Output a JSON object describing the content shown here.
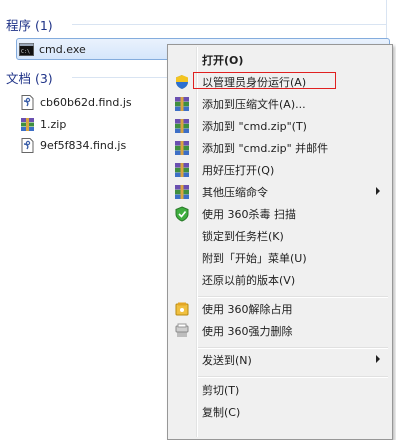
{
  "programs": {
    "header": "程序 (1)",
    "items": [
      {
        "name": "cmd.exe"
      }
    ]
  },
  "documents": {
    "header": "文档 (3)",
    "items": [
      {
        "name": "cb60b62d.find.js",
        "icon": "js-file-icon"
      },
      {
        "name": "1.zip",
        "icon": "zip-archive-icon"
      },
      {
        "name": "9ef5f834.find.js",
        "icon": "js-file-icon"
      }
    ]
  },
  "context_menu": {
    "items": [
      {
        "label": "打开(O)",
        "bold": true
      },
      {
        "label": "以管理员身份运行(A)",
        "icon": "uac-shield-icon",
        "highlighted": true
      },
      {
        "label": "添加到压缩文件(A)...",
        "icon": "winrar-icon"
      },
      {
        "label": "添加到 \"cmd.zip\"(T)",
        "icon": "winrar-icon"
      },
      {
        "label": "添加到 \"cmd.zip\" 并邮件",
        "icon": "winrar-icon"
      },
      {
        "label": "用好压打开(Q)",
        "icon": "winrar-icon"
      },
      {
        "label": "其他压缩命令",
        "icon": "winrar-icon",
        "submenu": true
      },
      {
        "label": "使用 360杀毒 扫描",
        "icon": "360-shield-icon"
      },
      {
        "label": "锁定到任务栏(K)"
      },
      {
        "label": "附到「开始」菜单(U)"
      },
      {
        "label": "还原以前的版本(V)"
      },
      {
        "label": "使用 360解除占用",
        "icon": "360-unlock-icon"
      },
      {
        "label": "使用 360强力删除",
        "icon": "360-shred-icon"
      },
      {
        "label": "发送到(N)",
        "submenu": true
      },
      {
        "label": "剪切(T)"
      },
      {
        "label": "复制(C)"
      }
    ]
  }
}
